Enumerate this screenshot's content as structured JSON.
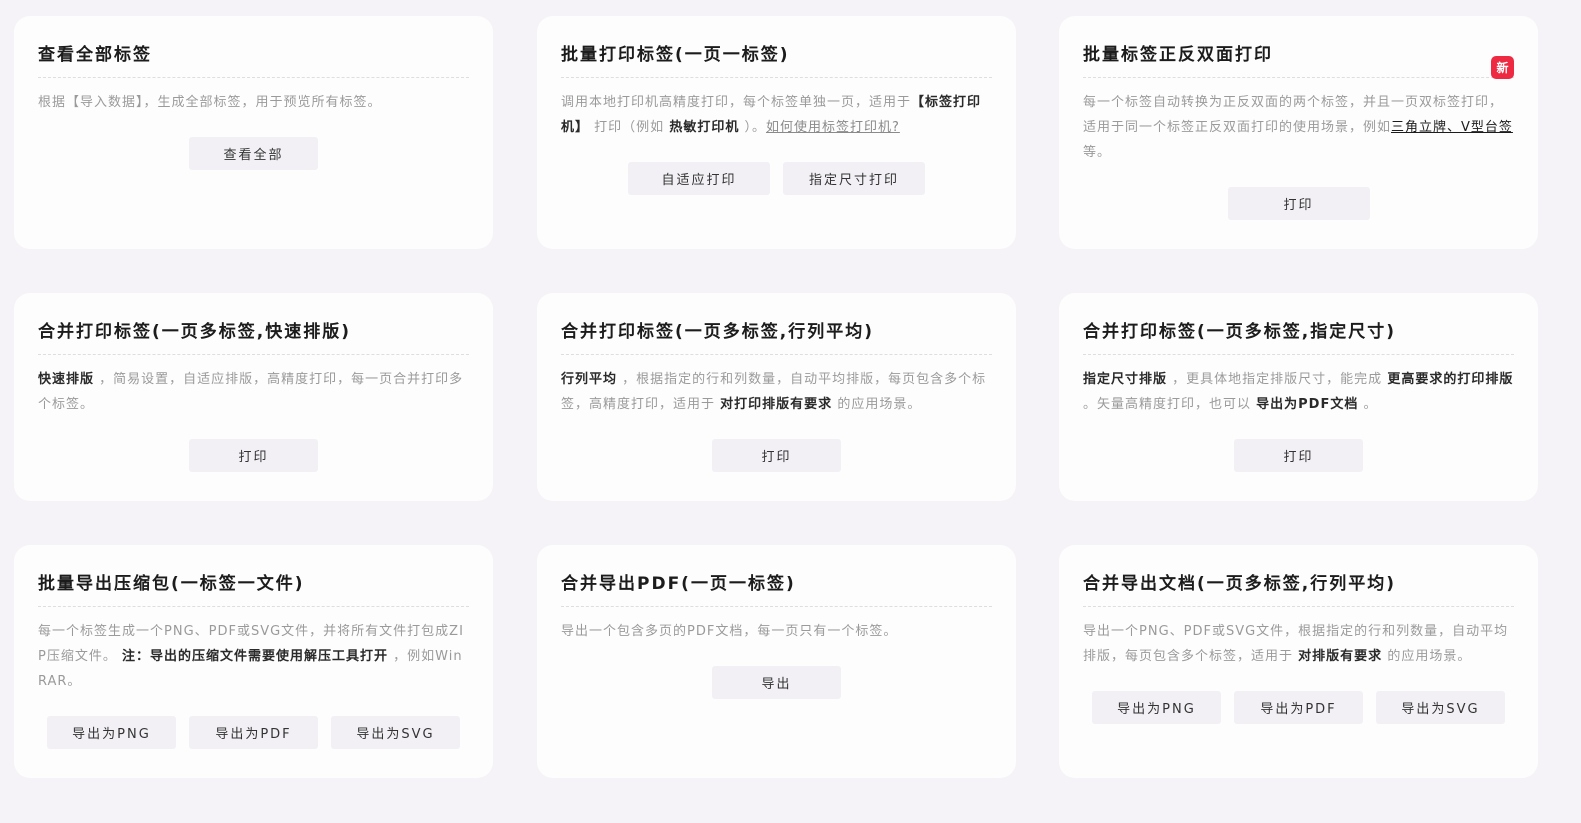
{
  "cards": {
    "view_all": {
      "title": "查看全部标签",
      "desc": "根据【导入数据】，生成全部标签，用于预览所有标签。",
      "button": "查看全部"
    },
    "batch_print": {
      "title": "批量打印标签(一页一标签)",
      "desc_1": "调用本地打印机高精度打印，每个标签单独一页，适用于",
      "desc_bold_1": "【标签打印机】",
      "desc_2": "打印（例如",
      "desc_bold_2": "热敏打印机",
      "desc_3": "）。",
      "desc_link": "如何使用标签打印机?",
      "button_1": "自适应打印",
      "button_2": "指定尺寸打印"
    },
    "duplex_print": {
      "title": "批量标签正反双面打印",
      "badge": "新",
      "desc_1": "每一个标签自动转换为正反双面的两个标签，并且一页双标签打印，适用于同一个标签正反双面打印的使用场景，例如",
      "desc_link": "三角立牌、V型台签",
      "desc_2": "等。",
      "button": "打印"
    },
    "merge_quick": {
      "title": "合并打印标签(一页多标签,快速排版)",
      "desc_bold_1": "快速排版",
      "desc_1": "，简易设置，自适应排版，高精度打印，每一页合并打印多个标签。",
      "button": "打印"
    },
    "merge_grid": {
      "title": "合并打印标签(一页多标签,行列平均)",
      "desc_bold_1": "行列平均",
      "desc_1": "，根据指定的行和列数量，自动平均排版，每页包含多个标签，高精度打印，适用于",
      "desc_bold_2": "对打印排版有要求",
      "desc_2": "的应用场景。",
      "button": "打印"
    },
    "merge_size": {
      "title": "合并打印标签(一页多标签,指定尺寸)",
      "desc_bold_1": "指定尺寸排版",
      "desc_1": "，更具体地指定排版尺寸，能完成",
      "desc_bold_2": "更高要求的打印排版",
      "desc_2": "。矢量高精度打印，也可以",
      "desc_bold_3": "导出为PDF文档",
      "desc_3": "。",
      "button": "打印"
    },
    "export_zip": {
      "title": "批量导出压缩包(一标签一文件)",
      "desc_1": "每一个标签生成一个PNG、PDF或SVG文件，并将所有文件打包成ZIP压缩文件。",
      "desc_bold_1": "注：导出的压缩文件需要使用解压工具打开",
      "desc_2": "，例如WinRAR。",
      "button_png": "导出为PNG",
      "button_pdf": "导出为PDF",
      "button_svg": "导出为SVG"
    },
    "export_pdf": {
      "title": "合并导出PDF(一页一标签)",
      "desc": "导出一个包含多页的PDF文档，每一页只有一个标签。",
      "button": "导出"
    },
    "export_doc": {
      "title": "合并导出文档(一页多标签,行列平均)",
      "desc_1": "导出一个PNG、PDF或SVG文件，根据指定的行和列数量，自动平均排版，每页包含多个标签，适用于",
      "desc_bold_1": "对排版有要求",
      "desc_2": "的应用场景。",
      "button_png": "导出为PNG",
      "button_pdf": "导出为PDF",
      "button_svg": "导出为SVG"
    }
  }
}
